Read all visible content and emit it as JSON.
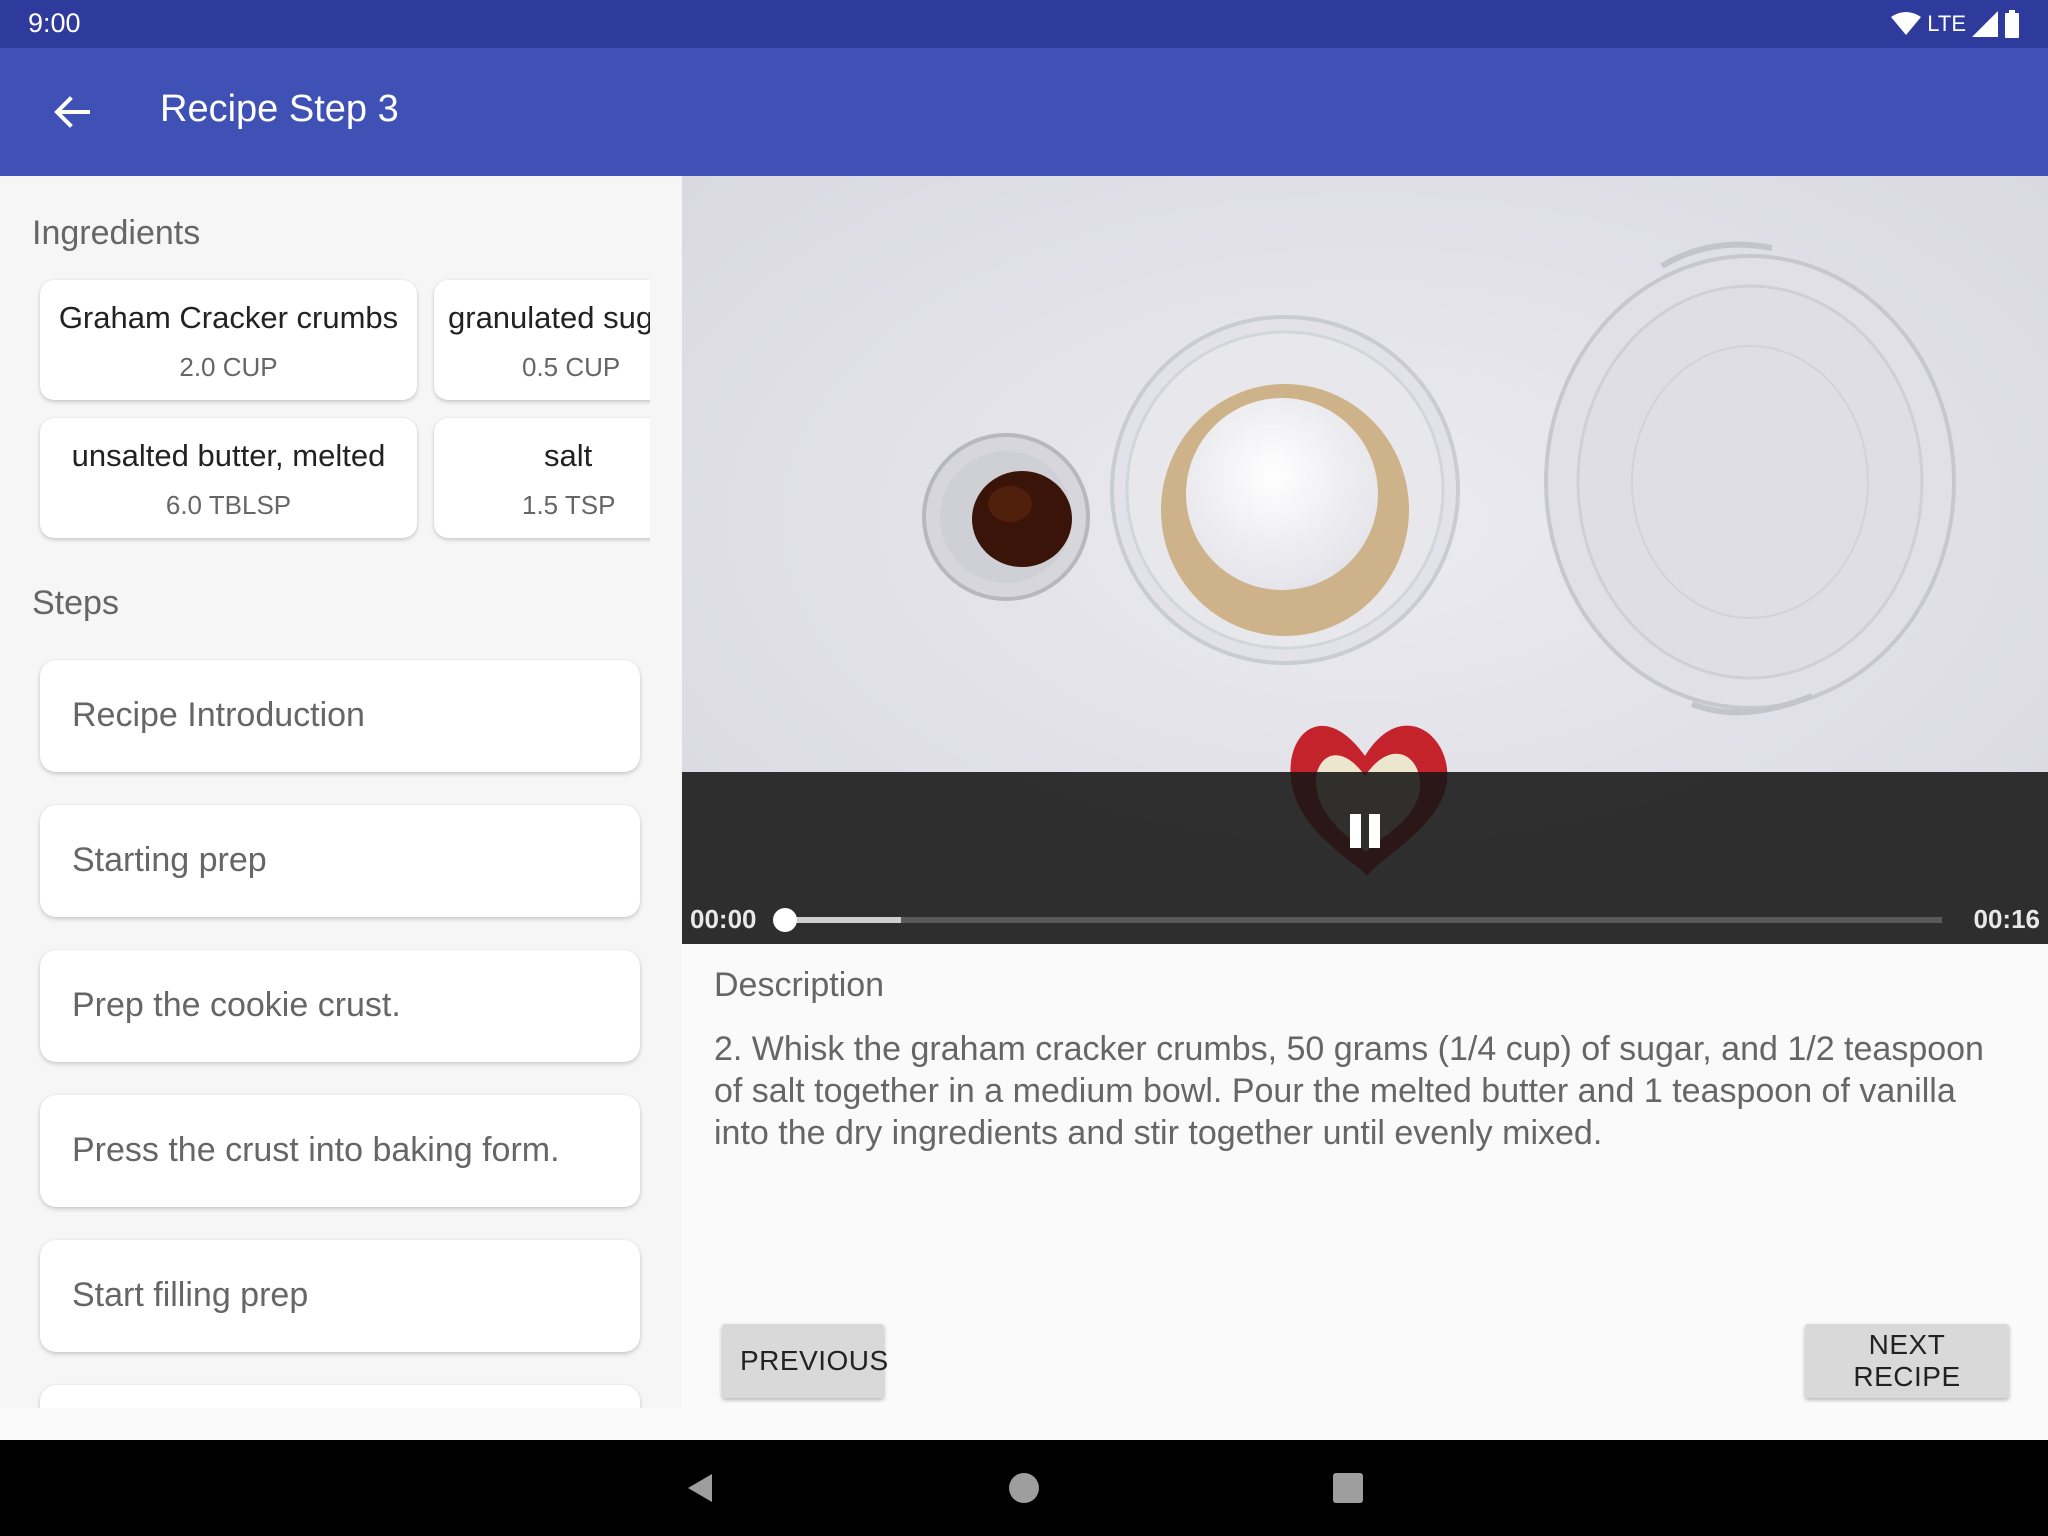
{
  "status_bar": {
    "time": "9:00",
    "network": "LTE",
    "icons": [
      "wifi-icon",
      "cell-signal-icon",
      "battery-icon"
    ]
  },
  "app_bar": {
    "title": "Recipe Step 3",
    "back_icon": "arrow-back-icon"
  },
  "ingredients": {
    "heading": "Ingredients",
    "items": [
      {
        "name": "Graham Cracker crumbs",
        "quantity": "2.0 CUP"
      },
      {
        "name": "granulated sugar",
        "quantity": "0.5 CUP"
      },
      {
        "name": "unsalted butter, melted",
        "quantity": "6.0 TBLSP"
      },
      {
        "name": "salt",
        "quantity": "1.5 TSP"
      }
    ]
  },
  "steps": {
    "heading": "Steps",
    "items": [
      {
        "label": "Recipe Introduction"
      },
      {
        "label": "Starting prep"
      },
      {
        "label": "Prep the cookie crust."
      },
      {
        "label": "Press the crust into baking form."
      },
      {
        "label": "Start filling prep"
      }
    ]
  },
  "player": {
    "position": "00:00",
    "duration": "00:16",
    "buffered_fraction": 0.1,
    "played_fraction": 0.0,
    "state_icon": "pause-icon"
  },
  "description": {
    "heading": "Description",
    "text": "2. Whisk the graham cracker crumbs, 50 grams (1/4 cup) of sugar, and 1/2 teaspoon of salt together in a medium bowl. Pour the melted butter and 1 teaspoon of vanilla into the dry ingredients and stir together until evenly mixed."
  },
  "buttons": {
    "previous": "PREVIOUS",
    "next": "NEXT RECIPE"
  },
  "nav_bar": {
    "icons": [
      "nav-back-icon",
      "nav-home-icon",
      "nav-recents-icon"
    ]
  },
  "colors": {
    "status_bar": "#2f3b9c",
    "app_bar": "#3f51b5",
    "background": "#fafafa"
  }
}
